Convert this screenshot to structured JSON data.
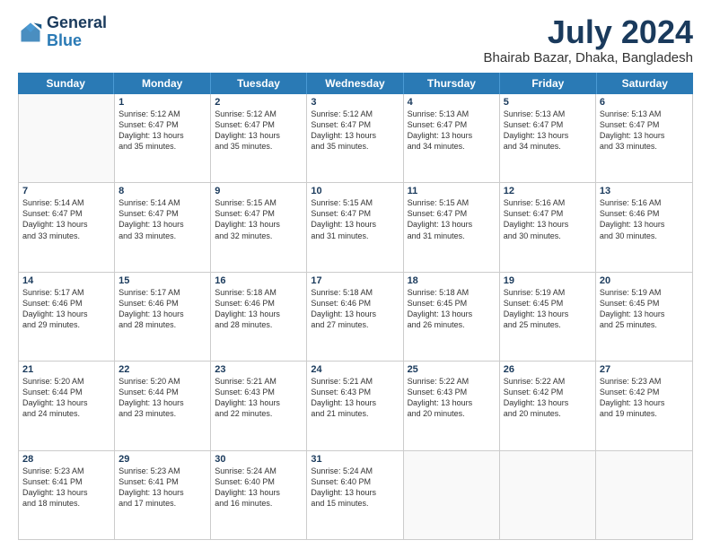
{
  "header": {
    "logo_line1": "General",
    "logo_line2": "Blue",
    "title": "July 2024",
    "subtitle": "Bhairab Bazar, Dhaka, Bangladesh"
  },
  "days_of_week": [
    "Sunday",
    "Monday",
    "Tuesday",
    "Wednesday",
    "Thursday",
    "Friday",
    "Saturday"
  ],
  "weeks": [
    [
      {
        "day": "",
        "info": ""
      },
      {
        "day": "1",
        "info": "Sunrise: 5:12 AM\nSunset: 6:47 PM\nDaylight: 13 hours\nand 35 minutes."
      },
      {
        "day": "2",
        "info": "Sunrise: 5:12 AM\nSunset: 6:47 PM\nDaylight: 13 hours\nand 35 minutes."
      },
      {
        "day": "3",
        "info": "Sunrise: 5:12 AM\nSunset: 6:47 PM\nDaylight: 13 hours\nand 35 minutes."
      },
      {
        "day": "4",
        "info": "Sunrise: 5:13 AM\nSunset: 6:47 PM\nDaylight: 13 hours\nand 34 minutes."
      },
      {
        "day": "5",
        "info": "Sunrise: 5:13 AM\nSunset: 6:47 PM\nDaylight: 13 hours\nand 34 minutes."
      },
      {
        "day": "6",
        "info": "Sunrise: 5:13 AM\nSunset: 6:47 PM\nDaylight: 13 hours\nand 33 minutes."
      }
    ],
    [
      {
        "day": "7",
        "info": "Sunrise: 5:14 AM\nSunset: 6:47 PM\nDaylight: 13 hours\nand 33 minutes."
      },
      {
        "day": "8",
        "info": "Sunrise: 5:14 AM\nSunset: 6:47 PM\nDaylight: 13 hours\nand 33 minutes."
      },
      {
        "day": "9",
        "info": "Sunrise: 5:15 AM\nSunset: 6:47 PM\nDaylight: 13 hours\nand 32 minutes."
      },
      {
        "day": "10",
        "info": "Sunrise: 5:15 AM\nSunset: 6:47 PM\nDaylight: 13 hours\nand 31 minutes."
      },
      {
        "day": "11",
        "info": "Sunrise: 5:15 AM\nSunset: 6:47 PM\nDaylight: 13 hours\nand 31 minutes."
      },
      {
        "day": "12",
        "info": "Sunrise: 5:16 AM\nSunset: 6:47 PM\nDaylight: 13 hours\nand 30 minutes."
      },
      {
        "day": "13",
        "info": "Sunrise: 5:16 AM\nSunset: 6:46 PM\nDaylight: 13 hours\nand 30 minutes."
      }
    ],
    [
      {
        "day": "14",
        "info": "Sunrise: 5:17 AM\nSunset: 6:46 PM\nDaylight: 13 hours\nand 29 minutes."
      },
      {
        "day": "15",
        "info": "Sunrise: 5:17 AM\nSunset: 6:46 PM\nDaylight: 13 hours\nand 28 minutes."
      },
      {
        "day": "16",
        "info": "Sunrise: 5:18 AM\nSunset: 6:46 PM\nDaylight: 13 hours\nand 28 minutes."
      },
      {
        "day": "17",
        "info": "Sunrise: 5:18 AM\nSunset: 6:46 PM\nDaylight: 13 hours\nand 27 minutes."
      },
      {
        "day": "18",
        "info": "Sunrise: 5:18 AM\nSunset: 6:45 PM\nDaylight: 13 hours\nand 26 minutes."
      },
      {
        "day": "19",
        "info": "Sunrise: 5:19 AM\nSunset: 6:45 PM\nDaylight: 13 hours\nand 25 minutes."
      },
      {
        "day": "20",
        "info": "Sunrise: 5:19 AM\nSunset: 6:45 PM\nDaylight: 13 hours\nand 25 minutes."
      }
    ],
    [
      {
        "day": "21",
        "info": "Sunrise: 5:20 AM\nSunset: 6:44 PM\nDaylight: 13 hours\nand 24 minutes."
      },
      {
        "day": "22",
        "info": "Sunrise: 5:20 AM\nSunset: 6:44 PM\nDaylight: 13 hours\nand 23 minutes."
      },
      {
        "day": "23",
        "info": "Sunrise: 5:21 AM\nSunset: 6:43 PM\nDaylight: 13 hours\nand 22 minutes."
      },
      {
        "day": "24",
        "info": "Sunrise: 5:21 AM\nSunset: 6:43 PM\nDaylight: 13 hours\nand 21 minutes."
      },
      {
        "day": "25",
        "info": "Sunrise: 5:22 AM\nSunset: 6:43 PM\nDaylight: 13 hours\nand 20 minutes."
      },
      {
        "day": "26",
        "info": "Sunrise: 5:22 AM\nSunset: 6:42 PM\nDaylight: 13 hours\nand 20 minutes."
      },
      {
        "day": "27",
        "info": "Sunrise: 5:23 AM\nSunset: 6:42 PM\nDaylight: 13 hours\nand 19 minutes."
      }
    ],
    [
      {
        "day": "28",
        "info": "Sunrise: 5:23 AM\nSunset: 6:41 PM\nDaylight: 13 hours\nand 18 minutes."
      },
      {
        "day": "29",
        "info": "Sunrise: 5:23 AM\nSunset: 6:41 PM\nDaylight: 13 hours\nand 17 minutes."
      },
      {
        "day": "30",
        "info": "Sunrise: 5:24 AM\nSunset: 6:40 PM\nDaylight: 13 hours\nand 16 minutes."
      },
      {
        "day": "31",
        "info": "Sunrise: 5:24 AM\nSunset: 6:40 PM\nDaylight: 13 hours\nand 15 minutes."
      },
      {
        "day": "",
        "info": ""
      },
      {
        "day": "",
        "info": ""
      },
      {
        "day": "",
        "info": ""
      }
    ]
  ]
}
